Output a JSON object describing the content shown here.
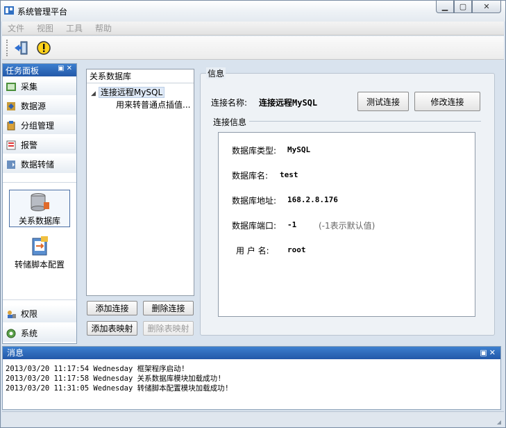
{
  "window": {
    "title": "系统管理平台"
  },
  "menu": [
    "文件",
    "视图",
    "工具",
    "帮助"
  ],
  "toolbar": {
    "icons": [
      "exit-icon",
      "warning-icon"
    ]
  },
  "task_panel": {
    "title": "任务面板",
    "items": [
      "采集",
      "数据源",
      "分组管理",
      "报警",
      "数据转储"
    ],
    "sub_items": [
      "关系数据库",
      "转储脚本配置"
    ],
    "bottom_items": [
      "权限",
      "系统"
    ]
  },
  "db_list": {
    "header": "关系数据库",
    "tree": {
      "node": "连接远程MySQL",
      "child": "用来转普通点插值..."
    },
    "buttons": {
      "add_connection": "添加连接",
      "delete_connection": "删除连接",
      "add_mapping": "添加表映射",
      "delete_mapping": "删除表映射"
    }
  },
  "info": {
    "legend": "信息",
    "conn_name_label": "连接名称:",
    "conn_name_value": "连接远程MySQL",
    "test_button": "测试连接",
    "modify_button": "修改连接",
    "conn_info_legend": "连接信息",
    "fields": [
      {
        "label": "数据库类型:",
        "value": "MySQL"
      },
      {
        "label": "数据库名:",
        "value": "test"
      },
      {
        "label": "数据库地址:",
        "value": "168.2.8.176"
      },
      {
        "label": "数据库端口:",
        "value": "-1",
        "note": "(-1表示默认值)"
      },
      {
        "label": "用 户 名:",
        "value": "root"
      }
    ]
  },
  "messages": {
    "title": "消息",
    "lines": [
      "2013/03/20 11:17:54 Wednesday 框架程序启动!",
      "2013/03/20 11:17:58 Wednesday 关系数据库模块加载成功!",
      "2013/03/20 11:31:05 Wednesday 转储脚本配置模块加载成功!"
    ]
  }
}
